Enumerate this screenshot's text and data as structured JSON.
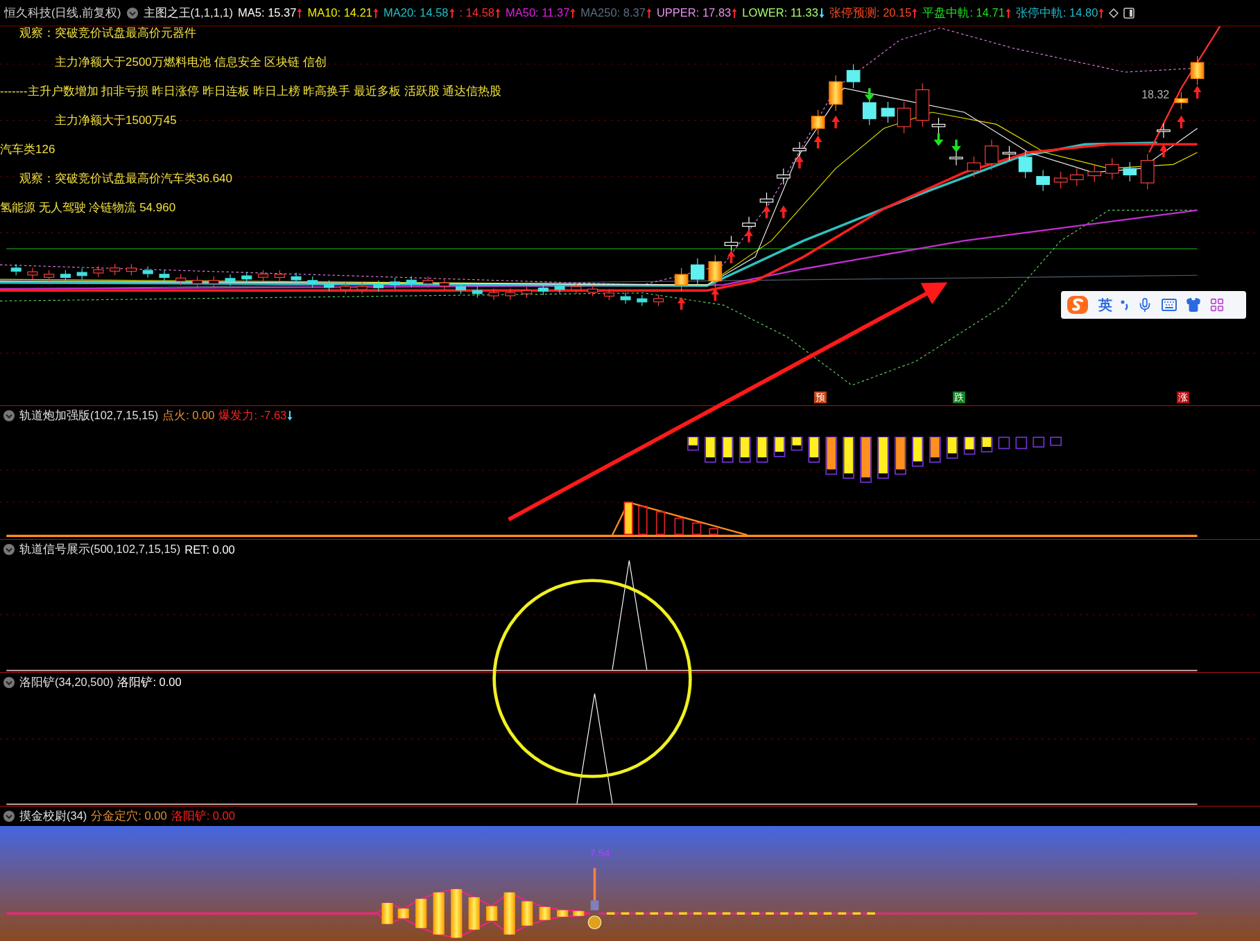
{
  "header": {
    "title": "恒久科技(日线,前复权)",
    "indicator": "主图之王(1,1,1,1)",
    "items": [
      {
        "text": "MA5: 15.37",
        "color": "#ffffff",
        "rising": true
      },
      {
        "text": "MA10: 14.21",
        "color": "#f0f000",
        "rising": true
      },
      {
        "text": "MA20: 14.58",
        "color": "#20c0c8",
        "rising": true
      },
      {
        "text": ": 14.58",
        "color": "#ff3030",
        "rising": true
      },
      {
        "text": "MA50: 11.37",
        "color": "#e020e0",
        "rising": true
      },
      {
        "text": "MA250: 8.37",
        "color": "#5a6e80",
        "rising": true
      },
      {
        "text": "UPPER: 17.83",
        "color": "#e890f0",
        "rising": true
      },
      {
        "text": "LOWER: 11.33",
        "color": "#a8ff70",
        "rising": false
      },
      {
        "text": "张停预测: 20.15",
        "color": "#ff4a20",
        "rising": true
      },
      {
        "text": "平盘中軌: 14.71",
        "color": "#20e020",
        "rising": true
      },
      {
        "text": "张停中軌: 14.80",
        "color": "#20b8c8",
        "rising": true
      }
    ]
  },
  "main_chart": {
    "notes": [
      {
        "kind": "observe",
        "text": "观察：突破竞价试盘最高价元器件"
      },
      {
        "kind": "net",
        "text": "主力净额大于2500万燃料电池 信息安全 区块链 信创"
      },
      {
        "kind": "plain",
        "text": "-------主升户数增加 扣非亏损 昨日涨停 昨日连板 昨日上榜 昨高换手 最近多板 活跃股 通达信热股"
      },
      {
        "kind": "net",
        "text": "主力净额大于1500万45"
      },
      {
        "kind": "plain",
        "text": "汽车类126"
      },
      {
        "kind": "observe",
        "text": "观察：突破竞价试盘最高价汽车类36.640"
      },
      {
        "kind": "plain",
        "text": "氢能源 无人驾驶 冷链物流 54.960"
      }
    ],
    "price_label": "18.32",
    "signals": [
      {
        "text": "预",
        "color": "#c04010"
      },
      {
        "text": "跌",
        "color": "#108020"
      },
      {
        "text": "涨",
        "color": "#b01010"
      }
    ]
  },
  "ime_toolbar": {
    "mode": "英"
  },
  "panels": [
    {
      "kind": "railgun",
      "name": "轨道炮加强版(102,7,15,15)",
      "values": [
        {
          "text": "点火: 0.00",
          "color": "#e89030"
        },
        {
          "text": "爆发力: -7.63",
          "color": "#ff2020",
          "rising": false
        }
      ]
    },
    {
      "kind": "signal",
      "name": "轨道信号展示(500,102,7,15,15)",
      "values": [
        {
          "text": "RET: 0.00",
          "color": "#ffffff"
        }
      ]
    },
    {
      "kind": "shovel",
      "name": "洛阳铲(34,20,500)",
      "values": [
        {
          "text": "洛阳铲: 0.00",
          "color": "#ffffff"
        }
      ]
    },
    {
      "kind": "gold",
      "name": "摸金校尉(34)",
      "values": [
        {
          "text": "分金定穴: 0.00",
          "color": "#e89030"
        },
        {
          "text": "洛阳铲: 0.00",
          "color": "#ff2020"
        }
      ],
      "peak_label": "7.54"
    }
  ]
}
